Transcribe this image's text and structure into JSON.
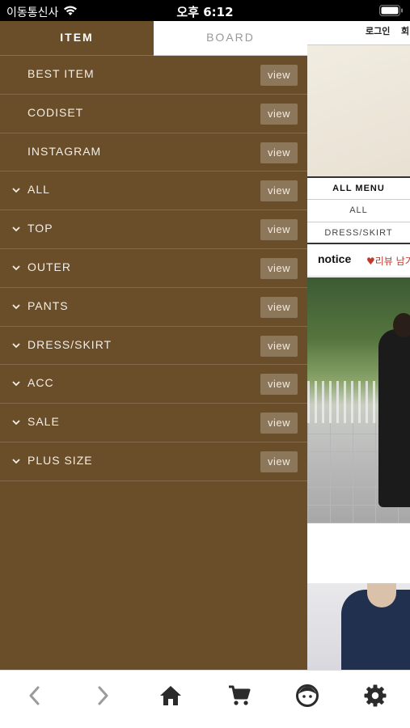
{
  "status_bar": {
    "carrier": "이동통신사",
    "time": "오후 6:12"
  },
  "drawer": {
    "tabs": [
      {
        "label": "ITEM"
      },
      {
        "label": "BOARD"
      }
    ],
    "items": [
      {
        "label": "BEST ITEM",
        "expandable": false,
        "button": "view"
      },
      {
        "label": "CODISET",
        "expandable": false,
        "button": "view"
      },
      {
        "label": "INSTAGRAM",
        "expandable": false,
        "button": "view"
      },
      {
        "label": "ALL",
        "expandable": true,
        "button": "view"
      },
      {
        "label": "TOP",
        "expandable": true,
        "button": "view"
      },
      {
        "label": "OUTER",
        "expandable": true,
        "button": "view"
      },
      {
        "label": "PANTS",
        "expandable": true,
        "button": "view"
      },
      {
        "label": "DRESS/SKIRT",
        "expandable": true,
        "button": "view"
      },
      {
        "label": "ACC",
        "expandable": true,
        "button": "view"
      },
      {
        "label": "SALE",
        "expandable": true,
        "button": "view"
      },
      {
        "label": "PLUS SIZE",
        "expandable": true,
        "button": "view"
      }
    ]
  },
  "background_page": {
    "login": "로그인",
    "join": "회",
    "menu": {
      "title": "ALL MENU",
      "links": [
        "ALL",
        "DRESS/SKIRT"
      ]
    },
    "notice": {
      "label": "notice",
      "review": "♥리뷰 남기"
    }
  },
  "toolbar": {
    "buttons": [
      "back-icon",
      "forward-icon",
      "home-icon",
      "cart-icon",
      "profile-icon",
      "settings-icon"
    ]
  },
  "colors": {
    "drawer": "#6a4d29",
    "view_button": "#8d775b",
    "toolbar_icon": "#2b2b2b",
    "review": "#c0392b"
  }
}
